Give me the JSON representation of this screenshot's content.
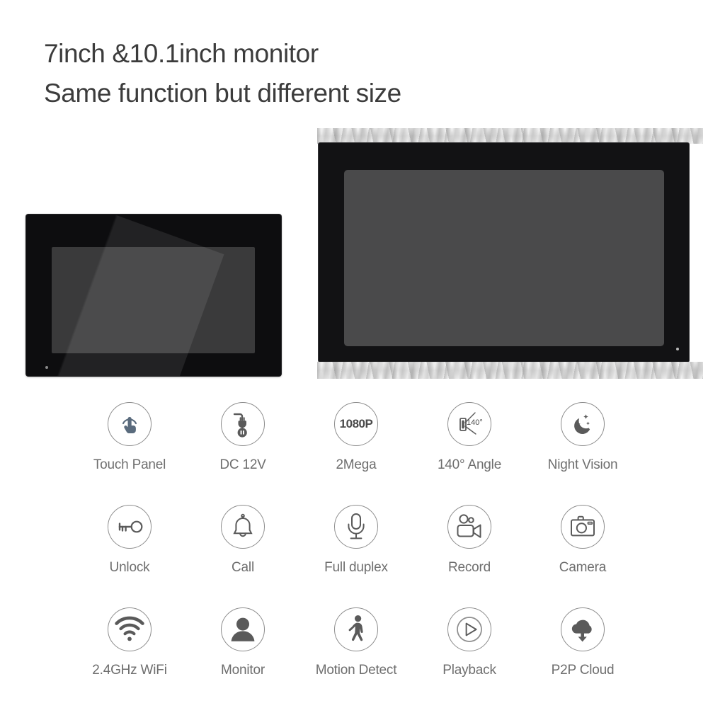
{
  "heading": {
    "line1": "7inch &10.1inch monitor",
    "line2": "Same function but different size"
  },
  "products": [
    {
      "name": "7inch monitor",
      "size_label": "7inch",
      "bezel_color": "#0d0d0f",
      "screen_color": "#3a3a3b"
    },
    {
      "name": "10.1inch monitor",
      "size_label": "10.1inch",
      "bezel_color": "#121214",
      "screen_color": "#4a4a4b"
    }
  ],
  "colors": {
    "background": "#ffffff",
    "heading_text": "#3c3c3c",
    "caption_text": "#6e6e6e",
    "icon_stroke": "#8c8c8c",
    "icon_fill": "#5a5a5a",
    "accent_blue": "#5a6b7d"
  },
  "features": [
    {
      "label": "Touch Panel",
      "icon": "touch-panel-icon"
    },
    {
      "label": "DC 12V",
      "icon": "power-plug-icon"
    },
    {
      "label": "2Mega",
      "icon": "resolution-icon",
      "icon_text": "1080P"
    },
    {
      "label": "140° Angle",
      "icon": "view-angle-icon",
      "icon_text": "140°"
    },
    {
      "label": "Night Vision",
      "icon": "moon-stars-icon"
    },
    {
      "label": "Unlock",
      "icon": "key-icon"
    },
    {
      "label": "Call",
      "icon": "bell-icon"
    },
    {
      "label": "Full duplex",
      "icon": "microphone-icon"
    },
    {
      "label": "Record",
      "icon": "video-camera-icon"
    },
    {
      "label": "Camera",
      "icon": "photo-camera-icon"
    },
    {
      "label": "2.4GHz WiFi",
      "icon": "wifi-icon"
    },
    {
      "label": "Monitor",
      "icon": "person-icon"
    },
    {
      "label": "Motion Detect",
      "icon": "walking-person-icon"
    },
    {
      "label": "Playback",
      "icon": "play-icon"
    },
    {
      "label": "P2P Cloud",
      "icon": "cloud-download-icon"
    }
  ]
}
